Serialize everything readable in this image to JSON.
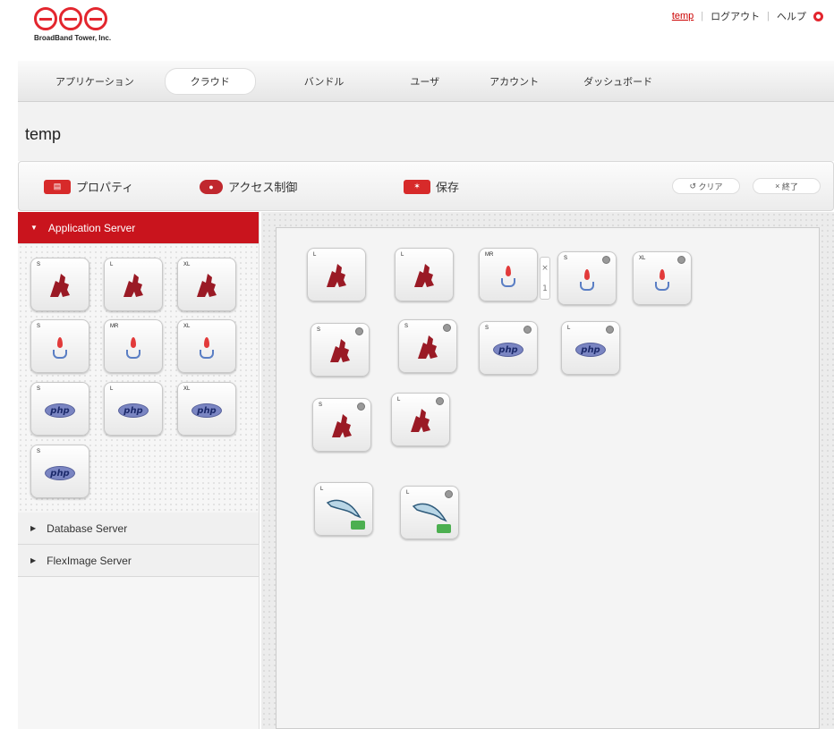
{
  "brand": {
    "company": "BroadBand Tower, Inc.",
    "accent": "#e3262e"
  },
  "topnav": {
    "user": "temp",
    "logout": "ログアウト",
    "help": "ヘルプ"
  },
  "mainnav": {
    "tabs": [
      "アプリケーション",
      "クラウド",
      "バンドル",
      "ユーザ",
      "アカウント",
      "ダッシュボード"
    ],
    "active": "クラウド"
  },
  "page": {
    "title": "temp"
  },
  "toolbar": {
    "properties": "プロパティ",
    "access": "アクセス制御",
    "save": "保存",
    "clear": "クリア",
    "exit": "終了"
  },
  "sidebar": {
    "sections": [
      {
        "label": "Application Server",
        "open": true
      },
      {
        "label": "Database Server",
        "open": false
      },
      {
        "label": "FlexImage Server",
        "open": false
      }
    ],
    "palette": [
      {
        "type": "ruby",
        "size": "S"
      },
      {
        "type": "ruby",
        "size": "L"
      },
      {
        "type": "ruby",
        "size": "XL"
      },
      {
        "type": "java",
        "size": "S"
      },
      {
        "type": "java",
        "size": "MR"
      },
      {
        "type": "java",
        "size": "XL"
      },
      {
        "type": "php",
        "size": "S"
      },
      {
        "type": "php",
        "size": "L"
      },
      {
        "type": "php",
        "size": "XL"
      },
      {
        "type": "php",
        "size": "S"
      }
    ]
  },
  "canvas": {
    "nodes": [
      {
        "type": "ruby",
        "size": "L"
      },
      {
        "type": "ruby",
        "size": "L"
      },
      {
        "type": "java",
        "size": "MR"
      },
      {
        "type": "java",
        "size": "S"
      },
      {
        "type": "java",
        "size": "XL"
      },
      {
        "type": "ruby",
        "size": "S"
      },
      {
        "type": "ruby",
        "size": "S"
      },
      {
        "type": "php",
        "size": "S"
      },
      {
        "type": "php",
        "size": "L"
      },
      {
        "type": "ruby",
        "size": "S"
      },
      {
        "type": "ruby",
        "size": "L"
      },
      {
        "type": "mysql",
        "size": "L"
      },
      {
        "type": "mysql",
        "size": "L"
      }
    ],
    "selected_controls": [
      "×",
      "1"
    ]
  }
}
